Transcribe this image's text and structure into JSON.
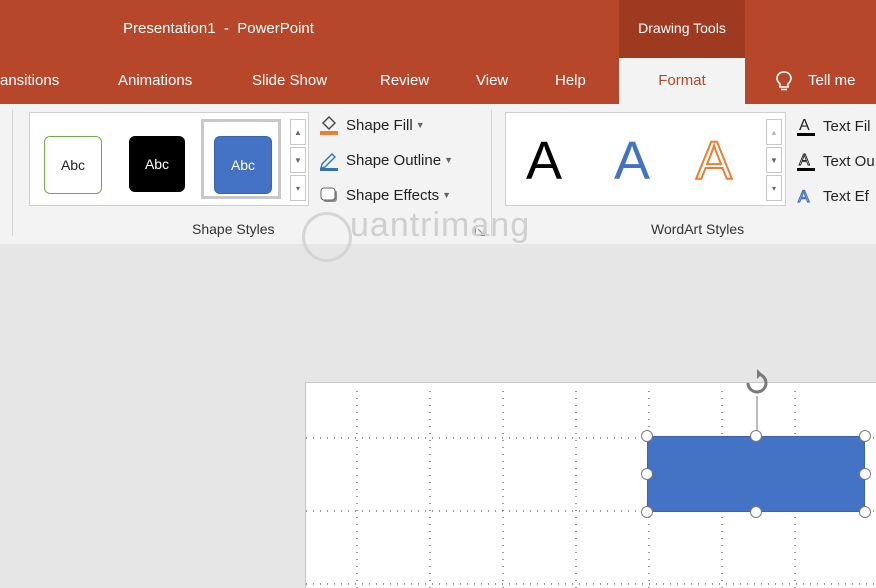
{
  "title_bar": {
    "title": "Presentation1  -  PowerPoint",
    "contextual_tab_group": "Drawing Tools"
  },
  "tabs": [
    {
      "label": "ansitions"
    },
    {
      "label": "Animations"
    },
    {
      "label": "Slide Show"
    },
    {
      "label": "Review"
    },
    {
      "label": "View"
    },
    {
      "label": "Help"
    },
    {
      "label": "Format",
      "active": true
    }
  ],
  "tell_me": "Tell me",
  "ribbon": {
    "shape_styles": {
      "group_label": "Shape Styles",
      "thumbnails": [
        {
          "label": "Abc",
          "style": "white-outline-green"
        },
        {
          "label": "Abc",
          "style": "black-fill"
        },
        {
          "label": "Abc",
          "style": "blue-fill",
          "selected": true
        }
      ],
      "shape_fill": "Shape Fill",
      "shape_outline": "Shape Outline",
      "shape_effects": "Shape Effects"
    },
    "wordart_styles": {
      "group_label": "WordArt Styles",
      "letters": [
        "A",
        "A",
        "A"
      ],
      "text_fill": "Text Fil",
      "text_outline": "Text Ou",
      "text_effects": "Text Ef"
    }
  },
  "watermark": "uantrimang",
  "colors": {
    "accent": "#b7472a",
    "shape_fill": "#4472c4",
    "ribbon_bg": "#f3f3f3"
  }
}
